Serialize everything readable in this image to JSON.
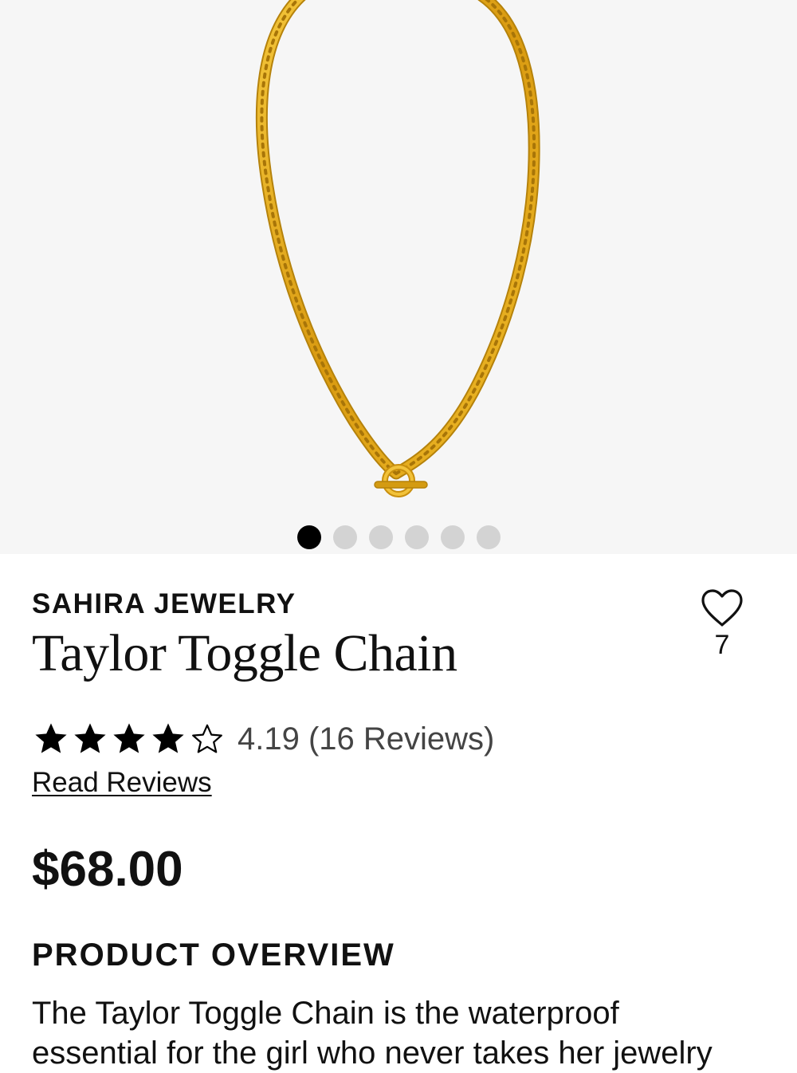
{
  "gallery": {
    "image_alt": "Taylor Toggle Chain gold necklace",
    "image_count": 6,
    "active_index": 0
  },
  "product": {
    "brand": "SAHIRA JEWELRY",
    "title": "Taylor Toggle Chain",
    "wishlist_icon": "heart-outline-icon",
    "wishlist_count": "7",
    "rating": 4.19,
    "rating_text": "4.19 (16 Reviews)",
    "stars_filled": 4,
    "stars_total": 5,
    "read_reviews_label": "Read Reviews",
    "price": "$68.00"
  },
  "overview": {
    "heading": "PRODUCT OVERVIEW",
    "text": "The Taylor Toggle Chain is the waterproof essential for the girl who never takes her jewelry"
  },
  "colors": {
    "gallery_bg": "#f6f6f6",
    "dot_active": "#000000",
    "dot_inactive": "#d3d3d3",
    "gold": "#e0a817",
    "rating_text": "#444444"
  }
}
